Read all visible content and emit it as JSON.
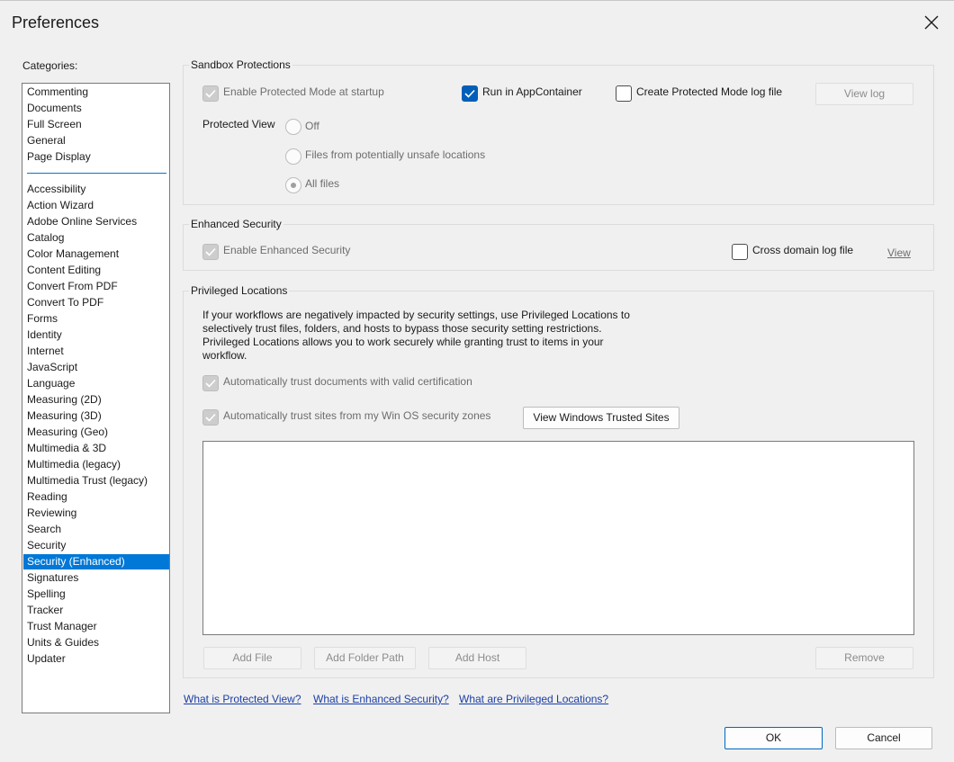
{
  "dialog": {
    "title": "Preferences",
    "close_icon": "close-icon"
  },
  "categories": {
    "label": "Categories:",
    "top_items": [
      "Commenting",
      "Documents",
      "Full Screen",
      "General",
      "Page Display"
    ],
    "items": [
      "Accessibility",
      "Action Wizard",
      "Adobe Online Services",
      "Catalog",
      "Color Management",
      "Content Editing",
      "Convert From PDF",
      "Convert To PDF",
      "Forms",
      "Identity",
      "Internet",
      "JavaScript",
      "Language",
      "Measuring (2D)",
      "Measuring (3D)",
      "Measuring (Geo)",
      "Multimedia & 3D",
      "Multimedia (legacy)",
      "Multimedia Trust (legacy)",
      "Reading",
      "Reviewing",
      "Search",
      "Security",
      "Security (Enhanced)",
      "Signatures",
      "Spelling",
      "Tracker",
      "Trust Manager",
      "Units & Guides",
      "Updater"
    ],
    "selected": "Security (Enhanced)"
  },
  "sandbox": {
    "title": "Sandbox Protections",
    "protected_mode_label": "Enable Protected Mode at startup",
    "protected_mode_checked": true,
    "appcontainer_label": "Run in AppContainer",
    "appcontainer_checked": true,
    "logfile_label": "Create Protected Mode log file",
    "logfile_checked": false,
    "view_log_button": "View log",
    "protected_view_label": "Protected View",
    "radio_off": "Off",
    "radio_unsafe": "Files from potentially unsafe locations",
    "radio_all": "All files",
    "protected_view_selected": "All files"
  },
  "enhanced": {
    "title": "Enhanced Security",
    "enable_label": "Enable Enhanced Security",
    "enable_checked": true,
    "cross_domain_label": "Cross domain log file",
    "cross_domain_checked": false,
    "view_link": "View"
  },
  "privileged": {
    "title": "Privileged Locations",
    "description": [
      "If your workflows are negatively impacted by security settings, use Privileged Locations to",
      "selectively trust files, folders, and hosts to bypass those security setting restrictions.",
      "Privileged Locations allows you to work securely while granting trust to items in your",
      "workflow."
    ],
    "trust_cert_label": "Automatically trust documents with valid certification",
    "trust_cert_checked": true,
    "trust_sites_label": "Automatically trust sites from my Win OS security zones",
    "trust_sites_checked": true,
    "view_trusted_sites_button": "View Windows Trusted Sites",
    "add_file_button": "Add File",
    "add_folder_button": "Add Folder Path",
    "add_host_button": "Add Host",
    "remove_button": "Remove"
  },
  "help_links": {
    "protected_view": "What is Protected View?",
    "enhanced_security": "What is Enhanced Security?",
    "privileged_locations": "What are Privileged Locations?"
  },
  "footer": {
    "ok_button": "OK",
    "cancel_button": "Cancel"
  },
  "colors": {
    "accent": "#0078d7",
    "checkbox_checked": "#005fb8",
    "link": "#1a3ea6"
  }
}
